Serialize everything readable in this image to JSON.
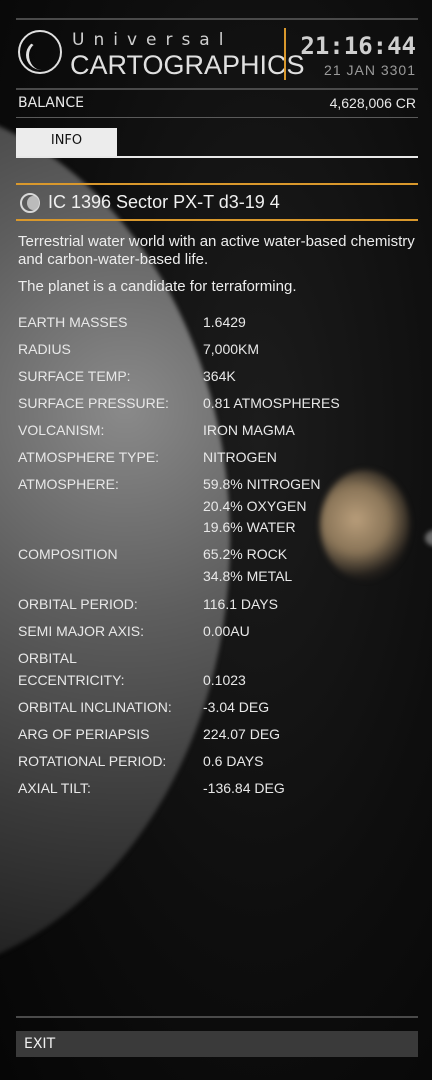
{
  "header": {
    "brand_top": "Universal",
    "brand_main": "CARTOGRAPHICS",
    "time": "21:16:44",
    "date": "21 JAN 3301"
  },
  "balance": {
    "label": "BALANCE",
    "value": "4,628,006 CR"
  },
  "tabs": [
    {
      "label": "INFO",
      "selected": true
    }
  ],
  "body": {
    "name": "IC 1396 Sector PX-T d3-19 4",
    "icon": "planet-icon",
    "description": "Terrestrial water world with an active water-based chemistry and carbon-water-based life.",
    "terraform_note": "The planet is a candidate for terraforming."
  },
  "properties": [
    {
      "key": "EARTH MASSES",
      "values": [
        "1.6429"
      ]
    },
    {
      "key": "RADIUS",
      "values": [
        "7,000KM"
      ]
    },
    {
      "key": "SURFACE TEMP:",
      "values": [
        "364K"
      ]
    },
    {
      "key": "SURFACE PRESSURE:",
      "values": [
        "0.81 ATMOSPHERES"
      ]
    },
    {
      "key": "VOLCANISM:",
      "values": [
        "IRON MAGMA"
      ]
    },
    {
      "key": "ATMOSPHERE TYPE:",
      "values": [
        "NITROGEN"
      ]
    },
    {
      "key": "ATMOSPHERE:",
      "values": [
        "59.8% NITROGEN",
        "20.4% OXYGEN",
        "19.6% WATER"
      ]
    },
    {
      "key": "COMPOSITION",
      "values": [
        "65.2% ROCK",
        "34.8% METAL"
      ]
    },
    {
      "key": "ORBITAL PERIOD:",
      "values": [
        "116.1 DAYS"
      ]
    },
    {
      "key": "SEMI MAJOR AXIS:",
      "values": [
        "0.00AU"
      ]
    },
    {
      "key": "ORBITAL",
      "key2": "ECCENTRICITY:",
      "values": [
        "0.1023"
      ]
    },
    {
      "key": "ORBITAL INCLINATION:",
      "values": [
        "-3.04 DEG"
      ]
    },
    {
      "key": "ARG OF PERIAPSIS",
      "values": [
        "224.07 DEG"
      ]
    },
    {
      "key": "ROTATIONAL PERIOD:",
      "values": [
        "0.6 DAYS"
      ]
    },
    {
      "key": "AXIAL TILT:",
      "values": [
        "-136.84 DEG"
      ]
    }
  ],
  "footer": {
    "exit_label": "EXIT"
  },
  "colors": {
    "accent": "#d9982c",
    "text": "#e8e8e8",
    "tab_bg": "#ececec",
    "exit_bg": "#3a3a3a"
  }
}
